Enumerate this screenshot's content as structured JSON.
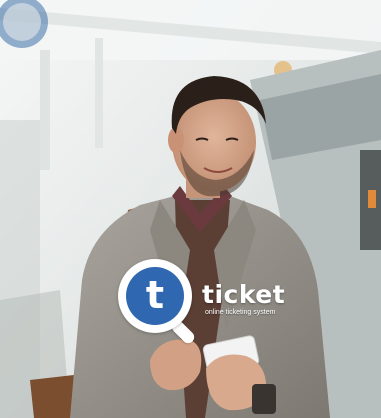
{
  "photo": {
    "subject": "man-with-smartphone",
    "colors": {
      "background": "#e9eceb",
      "jacket": "#9a958d",
      "shirt": "#5b3f35",
      "hair": "#2b2019",
      "skin": "#d8a98d",
      "bag_strap": "#8a5a35"
    }
  },
  "logo": {
    "letter": "t",
    "wordmark": "ticket",
    "tagline": "online ticketing system",
    "colors": {
      "circle": "#2f67b0",
      "ring": "#ffffff",
      "text": "#ffffff"
    }
  }
}
